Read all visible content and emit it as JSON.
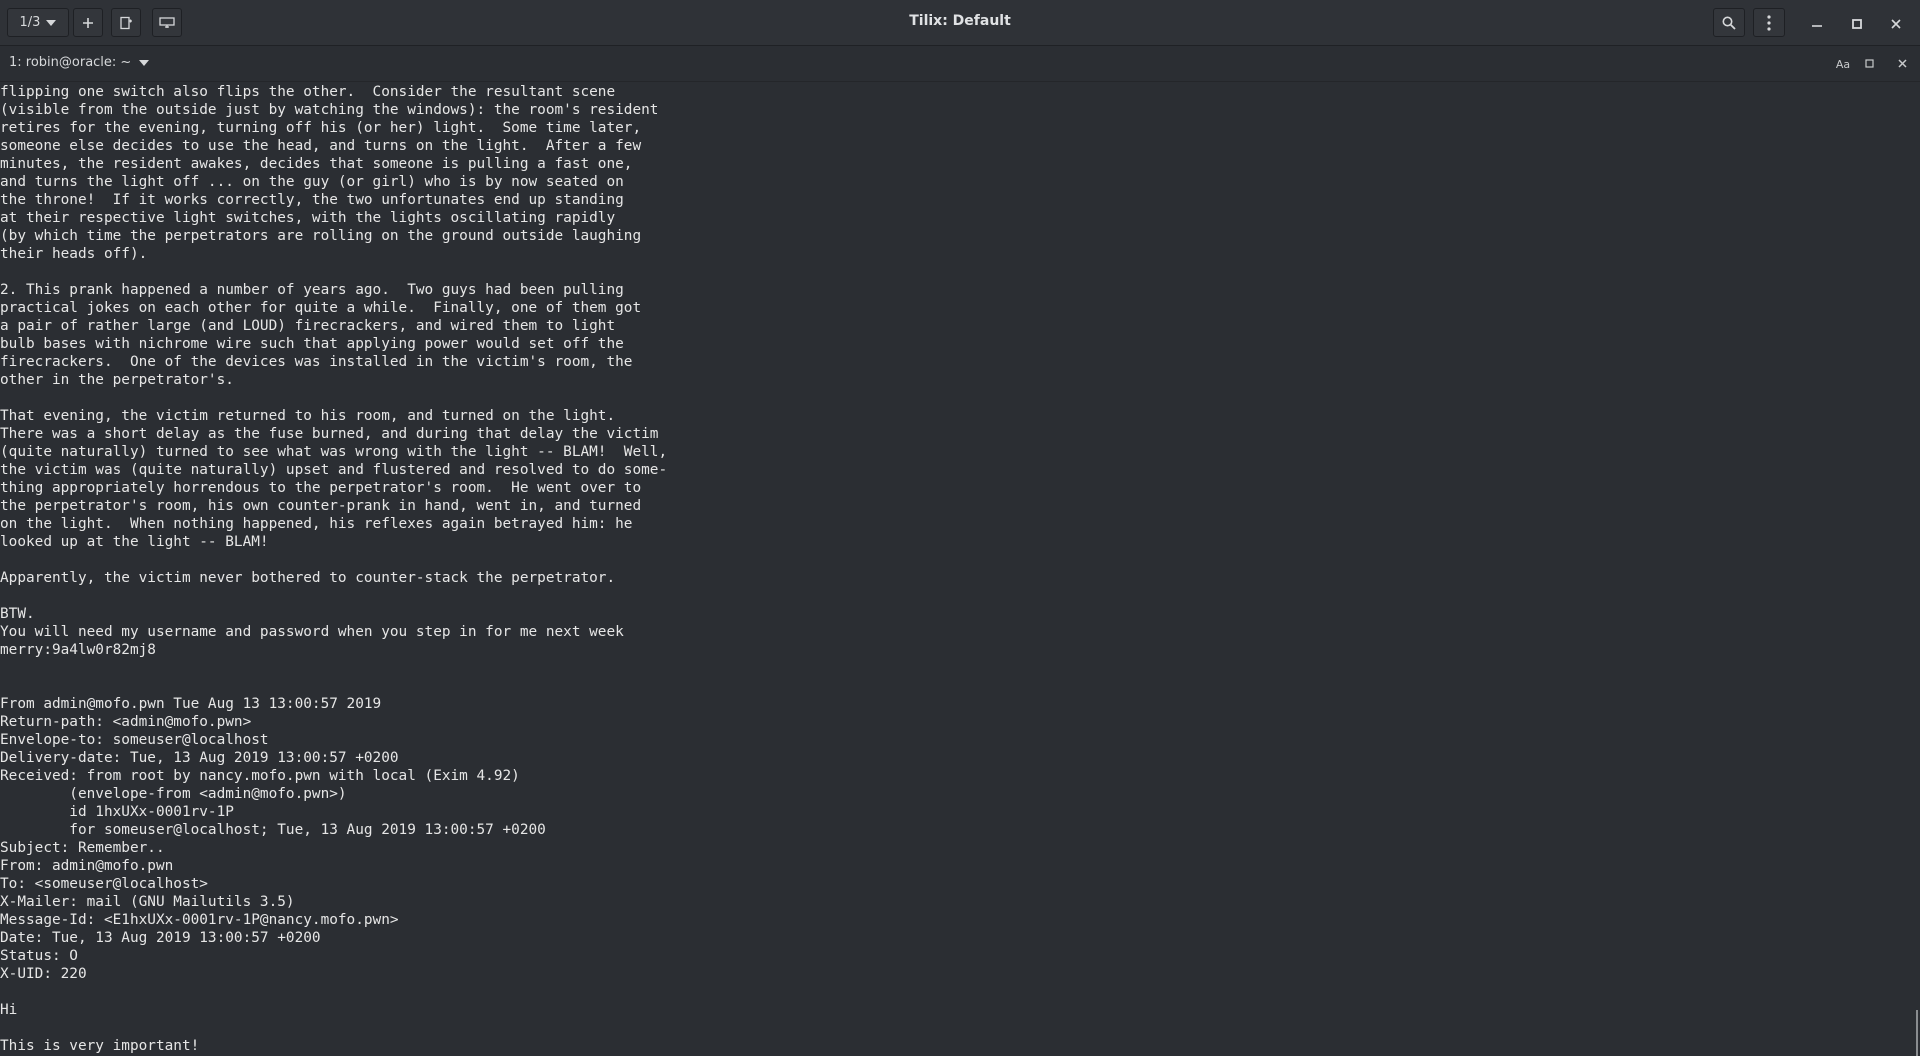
{
  "titlebar": {
    "session_label": "1/3",
    "title": "Tilix: Default"
  },
  "terminal_header": {
    "title": "1: robin@oracle: ~",
    "font_icon_text": "Aa"
  },
  "icons": {
    "session_dropdown": "chevron-down-icon",
    "add": "plus-icon",
    "add_right": "add-terminal-right-icon",
    "sync": "sync-input-icon",
    "search": "search-icon",
    "menu": "vertical-dots-icon",
    "minimize": "minimize-icon",
    "maximize": "maximize-icon",
    "close": "close-icon"
  },
  "terminal_lines": [
    "flipping one switch also flips the other.  Consider the resultant scene",
    "(visible from the outside just by watching the windows): the room's resident",
    "retires for the evening, turning off his (or her) light.  Some time later,",
    "someone else decides to use the head, and turns on the light.  After a few",
    "minutes, the resident awakes, decides that someone is pulling a fast one,",
    "and turns the light off ... on the guy (or girl) who is by now seated on",
    "the throne!  If it works correctly, the two unfortunates end up standing",
    "at their respective light switches, with the lights oscillating rapidly",
    "(by which time the perpetrators are rolling on the ground outside laughing",
    "their heads off).",
    "",
    "2. This prank happened a number of years ago.  Two guys had been pulling",
    "practical jokes on each other for quite a while.  Finally, one of them got",
    "a pair of rather large (and LOUD) firecrackers, and wired them to light",
    "bulb bases with nichrome wire such that applying power would set off the",
    "firecrackers.  One of the devices was installed in the victim's room, the",
    "other in the perpetrator's.",
    "",
    "That evening, the victim returned to his room, and turned on the light.",
    "There was a short delay as the fuse burned, and during that delay the victim",
    "(quite naturally) turned to see what was wrong with the light -- BLAM!  Well,",
    "the victim was (quite naturally) upset and flustered and resolved to do some-",
    "thing appropriately horrendous to the perpetrator's room.  He went over to",
    "the perpetrator's room, his own counter-prank in hand, went in, and turned",
    "on the light.  When nothing happened, his reflexes again betrayed him: he",
    "looked up at the light -- BLAM!",
    "",
    "Apparently, the victim never bothered to counter-stack the perpetrator.",
    "",
    "BTW.",
    "You will need my username and password when you step in for me next week",
    "merry:9a4lw0r82mj8",
    "",
    "",
    "From admin@mofo.pwn Tue Aug 13 13:00:57 2019",
    "Return-path: <admin@mofo.pwn>",
    "Envelope-to: someuser@localhost",
    "Delivery-date: Tue, 13 Aug 2019 13:00:57 +0200",
    "Received: from root by nancy.mofo.pwn with local (Exim 4.92)",
    "        (envelope-from <admin@mofo.pwn>)",
    "        id 1hxUXx-0001rv-1P",
    "        for someuser@localhost; Tue, 13 Aug 2019 13:00:57 +0200",
    "Subject: Remember..",
    "From: admin@mofo.pwn",
    "To: <someuser@localhost>",
    "X-Mailer: mail (GNU Mailutils 3.5)",
    "Message-Id: <E1hxUXx-0001rv-1P@nancy.mofo.pwn>",
    "Date: Tue, 13 Aug 2019 13:00:57 +0200",
    "Status: O",
    "X-UID: 220",
    "",
    "Hi",
    "",
    "This is very important!"
  ]
}
